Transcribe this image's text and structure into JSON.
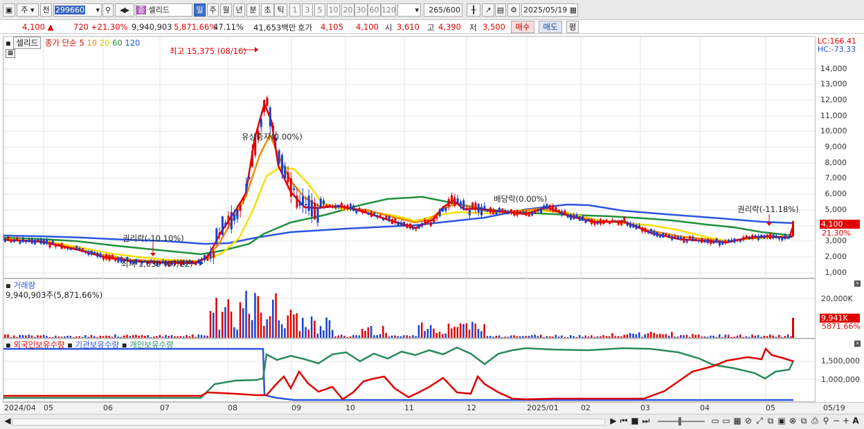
{
  "toolbar": {
    "market": "주",
    "prev_label": "전",
    "code": "299660",
    "stock_tag": "종",
    "stock_name": "셀리드",
    "periods": [
      "일",
      "주",
      "월",
      "년",
      "분",
      "초",
      "틱"
    ],
    "intervals": [
      "1",
      "3",
      "5",
      "10",
      "20",
      "30",
      "60",
      "120"
    ],
    "count": "265",
    "count_total": "/600",
    "date": "2025/05/19"
  },
  "quote": {
    "price": "4,100",
    "arrow": "▲",
    "change": "720",
    "change_pct": "+21.30%",
    "volume": "9,940,903",
    "volume_pct": "5,871.66%",
    "turnover_pct": "47.11%",
    "amount": "41,653백만",
    "hoga_label": "호가",
    "hoga1": "4,105",
    "hoga2": "4,100",
    "open_label": "시",
    "open": "3,610",
    "high_label": "고",
    "high": "4,390",
    "low_label": "저",
    "low": "3,500",
    "buy": "매수",
    "sell": "매도",
    "eval": "평"
  },
  "price_panel": {
    "name_box": "셀리드",
    "ma_title": "종가 단순",
    "ma": [
      {
        "label": "5",
        "color": "#e00000"
      },
      {
        "label": "10",
        "color": "#f08000"
      },
      {
        "label": "20",
        "color": "#e8d800"
      },
      {
        "label": "60",
        "color": "#20903a"
      },
      {
        "label": "120",
        "color": "#2050e0"
      }
    ],
    "lc": "LC:166.41",
    "hc": "HC:-73.33",
    "y_ticks": [
      "14,000",
      "13,000",
      "12,000",
      "11,000",
      "10,000",
      "9,000",
      "8,000",
      "7,000",
      "6,000",
      "5,000",
      "4,000",
      "3,000",
      "2,000",
      "1,000"
    ],
    "last_price_tag": "4,100",
    "last_pct": "21.30%",
    "annotations": {
      "high": "최고 15,375 (08/16)",
      "low": "최저 1,639 (07/22)",
      "rights1": "권리락(-10.10%)",
      "paid_in": "유상증자(0.00%)",
      "dividend": "배당락(0.00%)",
      "rights2": "권리락(-11.18%)"
    }
  },
  "volume_panel": {
    "title": "거래량",
    "value": "9,940,903주(5,871.66%)",
    "y_tick": "20,000K",
    "tag": "9,941K",
    "tag_pct": "5871.66%"
  },
  "holdings_panel": {
    "legend": [
      "외국인보유수량",
      "기관보유수량",
      "개인보유수량"
    ],
    "y_ticks": [
      "1,500,000",
      "1,000,000"
    ]
  },
  "x_axis": [
    "2024/04",
    "05",
    "06",
    "07",
    "08",
    "09",
    "10",
    "11",
    "12",
    "2025/01",
    "02",
    "03",
    "04",
    "05",
    "05/19"
  ]
}
